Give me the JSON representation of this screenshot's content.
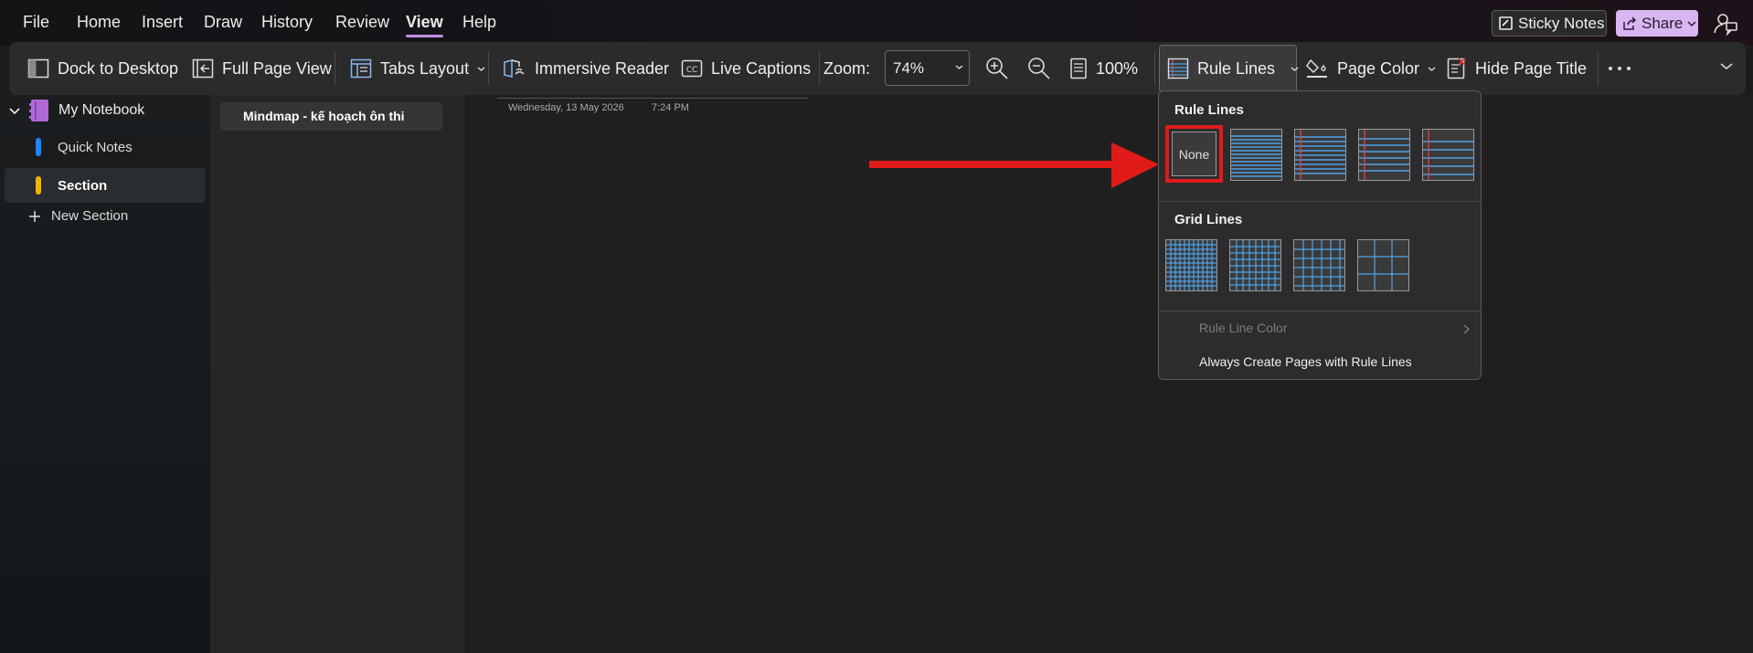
{
  "menu": {
    "items": [
      "File",
      "Home",
      "Insert",
      "Draw",
      "History",
      "Review",
      "View",
      "Help"
    ],
    "active": "View"
  },
  "topright": {
    "sticky_notes_label": "Sticky Notes",
    "share_label": "Share"
  },
  "ribbon": {
    "dock_label": "Dock to Desktop",
    "full_page_label": "Full Page View",
    "tabs_layout_label": "Tabs Layout",
    "immersive_label": "Immersive Reader",
    "captions_label": "Live Captions",
    "zoom_label": "Zoom:",
    "zoom_value": "74%",
    "hundred_label": "100%",
    "rule_lines_label": "Rule Lines",
    "page_color_label": "Page Color",
    "hide_title_label": "Hide Page Title"
  },
  "nav": {
    "notebook": "My Notebook",
    "sections": [
      {
        "label": "Quick Notes",
        "color": "#1a86ff"
      },
      {
        "label": "Section",
        "color": "#f5b400"
      }
    ],
    "new_section": "New Section"
  },
  "pages": {
    "items": [
      "Mindmap - kế hoạch ôn thi"
    ]
  },
  "page": {
    "date": "Wednesday, 13 May 2026",
    "time": "7:24 PM"
  },
  "dropdown": {
    "rule_heading": "Rule Lines",
    "none_label": "None",
    "grid_heading": "Grid Lines",
    "rule_color_label": "Rule Line Color",
    "always_label": "Always Create Pages with Rule Lines"
  },
  "colors": {
    "accent": "#c08ce0",
    "share_bg": "#d9b6f2",
    "annotation_red": "#e11a1a",
    "rule_blue": "#4ea2e8"
  }
}
